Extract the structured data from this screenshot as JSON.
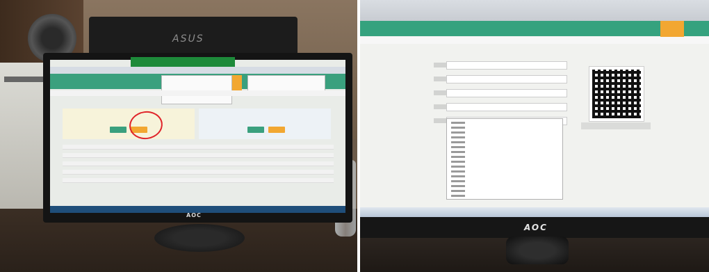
{
  "photos": [
    {
      "id": "left",
      "description_tags": [
        "office-desk",
        "aoc-monitor",
        "web-form-screen",
        "red-highlight-circle"
      ],
      "monitor_brand": "AOC",
      "background_monitor_brand": "ASUS"
    },
    {
      "id": "right",
      "description_tags": [
        "aoc-monitor",
        "registration-form",
        "open-dropdown",
        "qr-code"
      ],
      "monitor_brand": "AOC"
    }
  ],
  "colors": {
    "header_green": "#35a27e",
    "accent_orange": "#f2a731",
    "highlight_red": "#e0242a",
    "banner_green": "#1d8a3a"
  }
}
